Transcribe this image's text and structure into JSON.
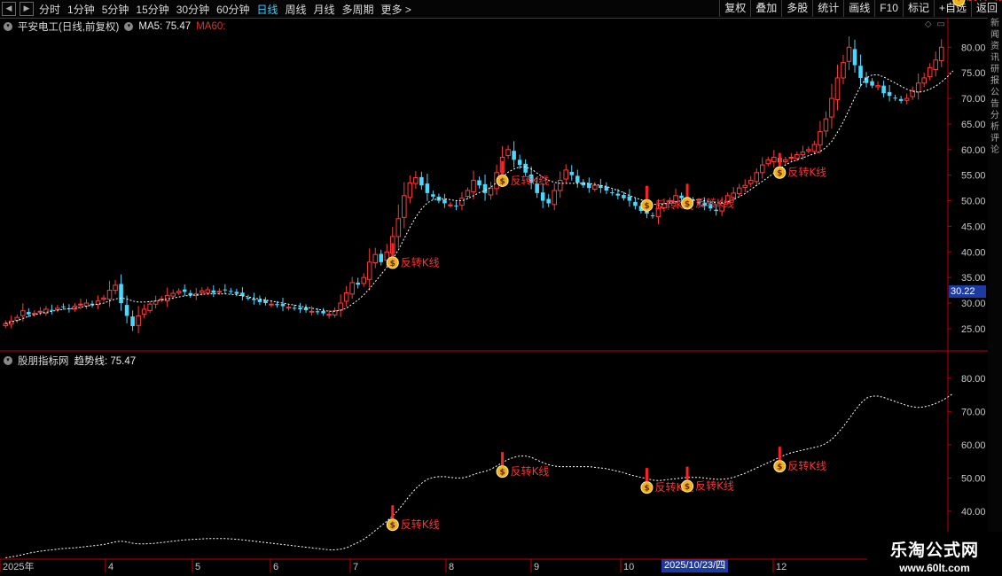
{
  "toolbar": {
    "periods": [
      "分时",
      "1分钟",
      "5分钟",
      "15分钟",
      "30分钟",
      "60分钟",
      "日线",
      "周线",
      "月线",
      "多周期",
      "更多 >"
    ],
    "active_period": "日线",
    "buttons": [
      "复权",
      "叠加",
      "多股",
      "统计",
      "画线",
      "F10",
      "标记",
      "+自选",
      "返回"
    ]
  },
  "main_pane": {
    "stock_title": "平安电工(日线,前复权)",
    "ma5_label": "MA5: 75.47",
    "ma60_label": "MA60:",
    "y_ticks": [
      "80.00",
      "75.00",
      "70.00",
      "65.00",
      "60.00",
      "55.00",
      "50.00",
      "45.00",
      "40.00",
      "35.00",
      "30.00",
      "25.00"
    ],
    "current_price_tag": "30.22"
  },
  "indicator_pane": {
    "title": "股朋指标网",
    "line_label": "趋势线: 75.47",
    "y_ticks": [
      "80.00",
      "70.00",
      "60.00",
      "50.00",
      "40.00"
    ]
  },
  "signals": {
    "label": "反转K线",
    "label_partial": "反"
  },
  "x_axis": {
    "labels": [
      "2025年",
      "4",
      "5",
      "6",
      "7",
      "8",
      "9",
      "10",
      "12"
    ],
    "cursor_date": "2025/10/23/四"
  },
  "watermark": {
    "title": "乐淘公式网",
    "url": "www.60lt.com"
  },
  "side_strip": [
    "新",
    "闻",
    "资",
    "讯",
    "研",
    "报",
    "公",
    "告",
    "分",
    "析",
    "评",
    "论"
  ],
  "colors": {
    "up": "#ff3b3b",
    "down": "#4ad8ff",
    "axis": "#c00000",
    "signal_text": "#ff3030",
    "active": "#3ad0ff"
  },
  "chart_data": {
    "type": "candlestick",
    "ylim": [
      21,
      83
    ],
    "indicator_ylim": [
      28,
      85
    ],
    "x_labels": [
      "2025年",
      "4",
      "5",
      "6",
      "7",
      "8",
      "9",
      "10",
      "12"
    ],
    "closes": [
      26,
      26.5,
      27.2,
      28.5,
      27.8,
      28,
      28.4,
      28.8,
      28.6,
      29,
      29.2,
      28.8,
      29.4,
      29.8,
      30,
      29.6,
      30.4,
      31,
      32.5,
      33.5,
      30,
      27.5,
      25.5,
      27.5,
      28.8,
      29.8,
      30.4,
      30.8,
      31.5,
      31.9,
      32.3,
      32.2,
      31.5,
      31.8,
      32.4,
      32.6,
      32,
      32.3,
      32.6,
      32.2,
      31.8,
      31.4,
      31,
      30.6,
      30.2,
      30,
      29.8,
      29.6,
      29.4,
      29.2,
      29,
      28.8,
      28.6,
      28.4,
      28.2,
      28,
      27.8,
      28.5,
      30,
      32,
      34,
      33.6,
      35,
      38,
      39.5,
      38,
      40,
      43,
      46.5,
      51,
      53.5,
      54.5,
      53,
      51.5,
      50.8,
      50,
      49.5,
      49.2,
      49,
      50.5,
      52,
      54,
      53,
      51.5,
      52.5,
      55.5,
      58.5,
      60,
      58,
      57,
      55.5,
      53.5,
      51.5,
      50,
      49.5,
      52,
      54,
      56,
      55,
      53.5,
      53,
      52.5,
      53,
      52.5,
      52,
      51.5,
      51,
      50.5,
      50,
      49,
      48,
      47.5,
      47,
      48.5,
      49.5,
      50,
      51,
      50.5,
      50.5,
      50,
      49.5,
      49,
      48.5,
      48,
      49.5,
      51,
      51.5,
      52.5,
      53,
      54,
      55.5,
      57,
      58,
      58.5,
      57.5,
      58,
      58.5,
      59,
      59.5,
      60,
      61,
      63.5,
      66,
      70,
      74,
      77,
      80,
      76.5,
      74,
      73,
      72.5,
      72.5,
      71,
      70.5,
      70,
      69.5,
      70,
      71.5,
      73,
      74,
      76,
      77.5,
      80
    ],
    "ma_line": [
      26,
      26.3,
      26.6,
      27,
      27.4,
      27.7,
      28,
      28.2,
      28.4,
      28.6,
      28.8,
      28.9,
      29,
      29.2,
      29.4,
      29.6,
      29.8,
      30,
      30.4,
      30.8,
      31,
      30.8,
      30.4,
      30.2,
      30.2,
      30.3,
      30.4,
      30.6,
      30.8,
      31,
      31.2,
      31.4,
      31.5,
      31.6,
      31.7,
      31.8,
      31.8,
      31.8,
      31.8,
      31.7,
      31.6,
      31.4,
      31.2,
      31,
      30.8,
      30.6,
      30.4,
      30.2,
      30,
      29.8,
      29.6,
      29.4,
      29.2,
      29,
      28.8,
      28.6,
      28.4,
      28.4,
      28.6,
      29,
      29.8,
      30.6,
      31.6,
      32.8,
      34.2,
      35.6,
      37,
      38.6,
      40.4,
      42.6,
      44.8,
      46.8,
      48.4,
      49.6,
      50.2,
      50.4,
      50.4,
      50.2,
      50,
      50,
      50.4,
      51,
      51.6,
      52,
      52.6,
      53.6,
      54.6,
      55.6,
      56.2,
      56.6,
      56.6,
      56.2,
      55.4,
      54.6,
      54,
      53.6,
      53.4,
      53.4,
      53.4,
      53.4,
      53.4,
      53.4,
      53.2,
      53,
      52.8,
      52.4,
      52,
      51.6,
      51,
      50.6,
      50.2,
      49.8,
      49.4,
      49.2,
      49.4,
      49.6,
      49.8,
      50,
      50.2,
      50.2,
      50.2,
      50,
      49.8,
      49.6,
      49.6,
      49.8,
      50.2,
      50.8,
      51.4,
      52.2,
      53,
      53.8,
      54.6,
      55.4,
      56.2,
      57,
      57.6,
      58,
      58.4,
      58.8,
      59.2,
      59.6,
      60.4,
      61.6,
      63.4,
      65.4,
      67.8,
      70.2,
      72.4,
      74,
      74.6,
      74.6,
      74.2,
      73.6,
      73,
      72.4,
      71.8,
      71.4,
      71.2,
      71.4,
      71.8,
      72.4,
      73.2,
      74.2,
      75.4
    ],
    "signal_indices": [
      67,
      86,
      111,
      118,
      134,
      165,
      174
    ],
    "series": [
      {
        "name": "MA5",
        "value": 75.47
      },
      {
        "name": "趋势线",
        "value": 75.47
      }
    ]
  }
}
